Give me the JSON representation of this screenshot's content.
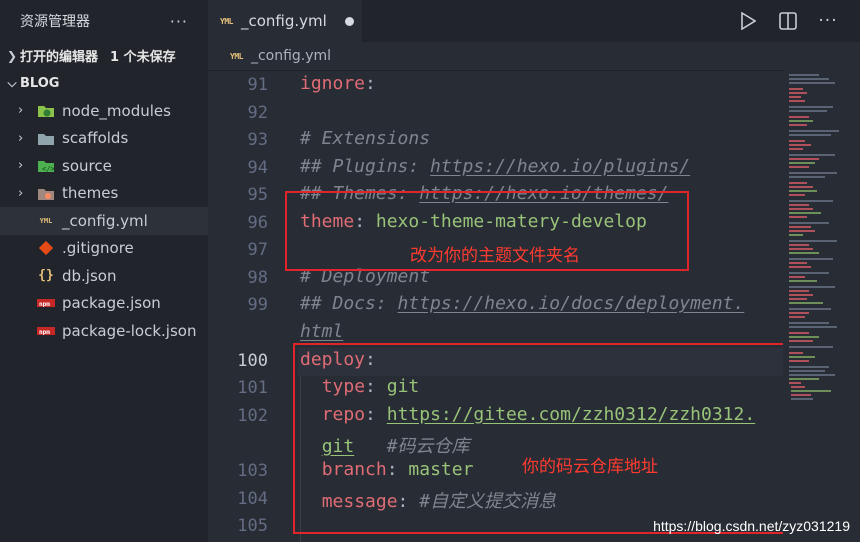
{
  "sidebar": {
    "title": "资源管理器",
    "more": "···",
    "open_editors": {
      "label": "打开的编辑器",
      "unsaved": "1 个未保存"
    },
    "folder": "BLOG",
    "items": [
      {
        "name": "node_modules",
        "icon": "node-folder-icon",
        "expandable": true
      },
      {
        "name": "scaffolds",
        "icon": "folder-icon",
        "expandable": true
      },
      {
        "name": "source",
        "icon": "source-folder-icon",
        "expandable": true
      },
      {
        "name": "themes",
        "icon": "themes-folder-icon",
        "expandable": true
      },
      {
        "name": "_config.yml",
        "icon": "yml-file-icon",
        "expandable": false,
        "selected": true
      },
      {
        "name": ".gitignore",
        "icon": "git-file-icon",
        "expandable": false
      },
      {
        "name": "db.json",
        "icon": "json-file-icon",
        "expandable": false
      },
      {
        "name": "package.json",
        "icon": "npm-file-icon",
        "expandable": false
      },
      {
        "name": "package-lock.json",
        "icon": "npm-file-icon",
        "expandable": false
      }
    ]
  },
  "tab": {
    "icon_text": "YML",
    "name": "_config.yml",
    "modified": true
  },
  "breadcrumb": {
    "icon_text": "YML",
    "name": "_config.yml"
  },
  "code_lines": [
    {
      "num": "91",
      "key": "ignore",
      "colon": ":"
    },
    {
      "num": "92"
    },
    {
      "num": "93",
      "comment": "# Extensions"
    },
    {
      "num": "94",
      "comment_prefix": "## Plugins: ",
      "comment_url": "https://hexo.io/plugins/"
    },
    {
      "num": "95",
      "comment_prefix": "## Themes: ",
      "comment_url": "https://hexo.io/themes/"
    },
    {
      "num": "96",
      "key": "theme",
      "colon": ": ",
      "value": "hexo-theme-matery-develop"
    },
    {
      "num": "97"
    },
    {
      "num": "98",
      "comment": "# Deployment"
    },
    {
      "num": "99",
      "comment_prefix": "## Docs: ",
      "comment_url": "https://hexo.io/docs/deployment.",
      "wrap": "html"
    },
    {
      "num": "100",
      "key": "deploy",
      "colon": ":"
    },
    {
      "num": "101",
      "indent": "  ",
      "key": "type",
      "colon": ": ",
      "value": "git"
    },
    {
      "num": "102",
      "indent": "  ",
      "key": "repo",
      "colon": ": ",
      "value": "https://gitee.com/zzh0312/zzh0312.",
      "wrap": "git",
      "wrap_comment": "   #码云仓库"
    },
    {
      "num": "103",
      "indent": "  ",
      "key": "branch",
      "colon": ": ",
      "value": "master"
    },
    {
      "num": "104",
      "indent": "  ",
      "key": "message",
      "colon": ": ",
      "comment": "#自定义提交消息"
    },
    {
      "num": "105"
    }
  ],
  "annotations": {
    "theme_note": "改为你的主题文件夹名",
    "repo_note": "你的码云仓库地址"
  },
  "watermark": "https://blog.csdn.net/zyz031219",
  "colors": {
    "key": "#e06c75",
    "string": "#98c379",
    "comment": "#7f848e",
    "annotation": "#e0262a"
  }
}
